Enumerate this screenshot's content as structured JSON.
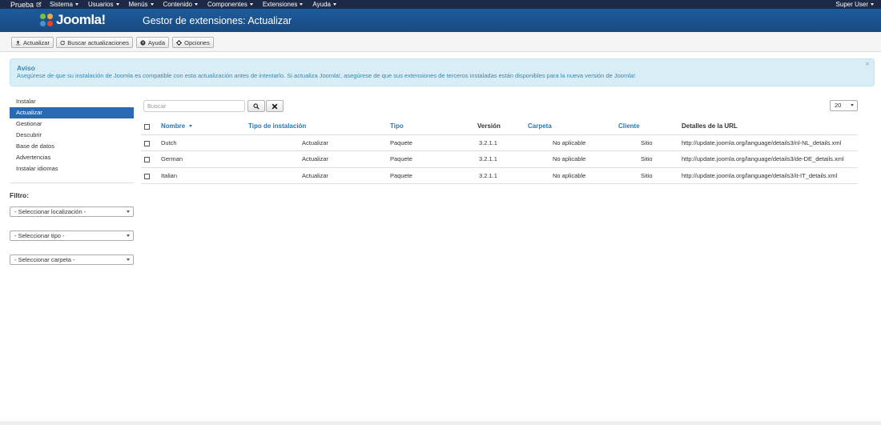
{
  "navbar": {
    "brand": "Prueba",
    "menu": [
      {
        "label": "Sistema"
      },
      {
        "label": "Usuarios"
      },
      {
        "label": "Menús"
      },
      {
        "label": "Contenido"
      },
      {
        "label": "Componentes"
      },
      {
        "label": "Extensiones"
      },
      {
        "label": "Ayuda"
      }
    ],
    "user": "Super User"
  },
  "header": {
    "logo_text": "Joomla!",
    "title": "Gestor de extensiones: Actualizar"
  },
  "toolbar": {
    "update_label": "Actualizar",
    "find_label": "Buscar actualizaciones",
    "help_label": "Ayuda",
    "options_label": "Opciones"
  },
  "alert": {
    "heading": "Aviso",
    "message": "Asegúrese de que su instalación de Joomla es compatible con esta actualización antes de intentarlo. Si actualiza Joomla!, asegúrese de que sus extensiones de terceros instaladas están disponibles para la nueva versión de Joomla!",
    "close": "×"
  },
  "sidebar": {
    "items": [
      {
        "label": "Instalar"
      },
      {
        "label": "Actualizar"
      },
      {
        "label": "Gestionar"
      },
      {
        "label": "Descubrir"
      },
      {
        "label": "Base de datos"
      },
      {
        "label": "Advertencias"
      },
      {
        "label": "Instalar idiomas"
      }
    ],
    "active_index": 1,
    "filter_title": "Filtro:",
    "filters": [
      {
        "label": "- Seleccionar localización -"
      },
      {
        "label": "- Seleccionar tipo -"
      },
      {
        "label": "- Seleccionar carpeta -"
      }
    ]
  },
  "search": {
    "placeholder": "Buscar"
  },
  "limit": {
    "value": "20"
  },
  "table": {
    "headers": {
      "name": "Nombre",
      "install_type": "Tipo de instalación",
      "type": "Tipo",
      "version": "Versión",
      "folder": "Carpeta",
      "client": "Cliente",
      "url": "Detalles de la URL"
    },
    "rows": [
      {
        "name": "Dutch",
        "install_type": "Actualizar",
        "type": "Paquete",
        "version": "3.2.1.1",
        "folder": "No aplicable",
        "client": "Sitio",
        "url": "http://update.joomla.org/language/details3/nl-NL_details.xml"
      },
      {
        "name": "German",
        "install_type": "Actualizar",
        "type": "Paquete",
        "version": "3.2.1.1",
        "folder": "No aplicable",
        "client": "Sitio",
        "url": "http://update.joomla.org/language/details3/de-DE_details.xml"
      },
      {
        "name": "Italian",
        "install_type": "Actualizar",
        "type": "Paquete",
        "version": "3.2.1.1",
        "folder": "No aplicable",
        "client": "Sitio",
        "url": "http://update.joomla.org/language/details3/it-IT_details.xml"
      }
    ]
  },
  "colors": {
    "navbar_bg": "#1c2a47",
    "header_bg": "#1d5b9c",
    "active_item": "#2a6ab5",
    "link": "#2a78b5",
    "alert_bg": "#d9edf7",
    "alert_text": "#3a87ad"
  }
}
